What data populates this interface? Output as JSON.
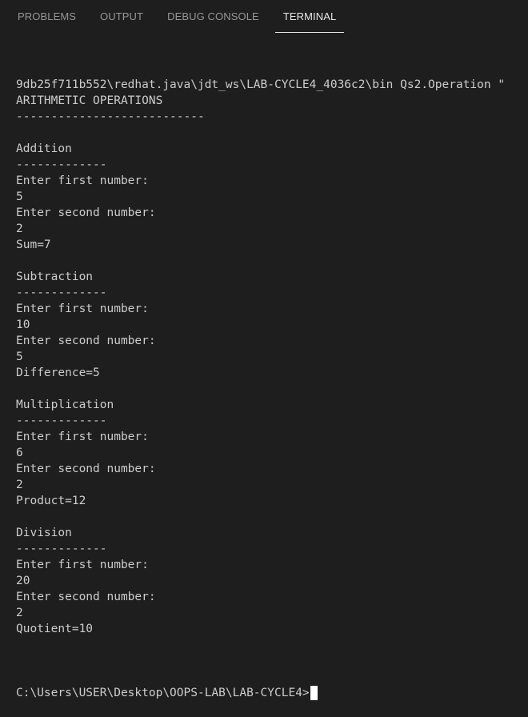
{
  "tabs": [
    {
      "label": "PROBLEMS",
      "active": false
    },
    {
      "label": "OUTPUT",
      "active": false
    },
    {
      "label": "DEBUG CONSOLE",
      "active": false
    },
    {
      "label": "TERMINAL",
      "active": true
    }
  ],
  "terminal": {
    "lines": [
      "9db25f711b552\\redhat.java\\jdt_ws\\LAB-CYCLE4_4036c2\\bin Qs2.Operation \"",
      "ARITHMETIC OPERATIONS",
      "---------------------------",
      "",
      "Addition",
      "-------------",
      "Enter first number:",
      "5",
      "Enter second number:",
      "2",
      "Sum=7",
      "",
      "Subtraction",
      "-------------",
      "Enter first number:",
      "10",
      "Enter second number:",
      "5",
      "Difference=5",
      "",
      "Multiplication",
      "-------------",
      "Enter first number:",
      "6",
      "Enter second number:",
      "2",
      "Product=12",
      "",
      "Division",
      "-------------",
      "Enter first number:",
      "20",
      "Enter second number:",
      "2",
      "Quotient=10",
      ""
    ],
    "prompt": "C:\\Users\\USER\\Desktop\\OOPS-LAB\\LAB-CYCLE4>"
  }
}
